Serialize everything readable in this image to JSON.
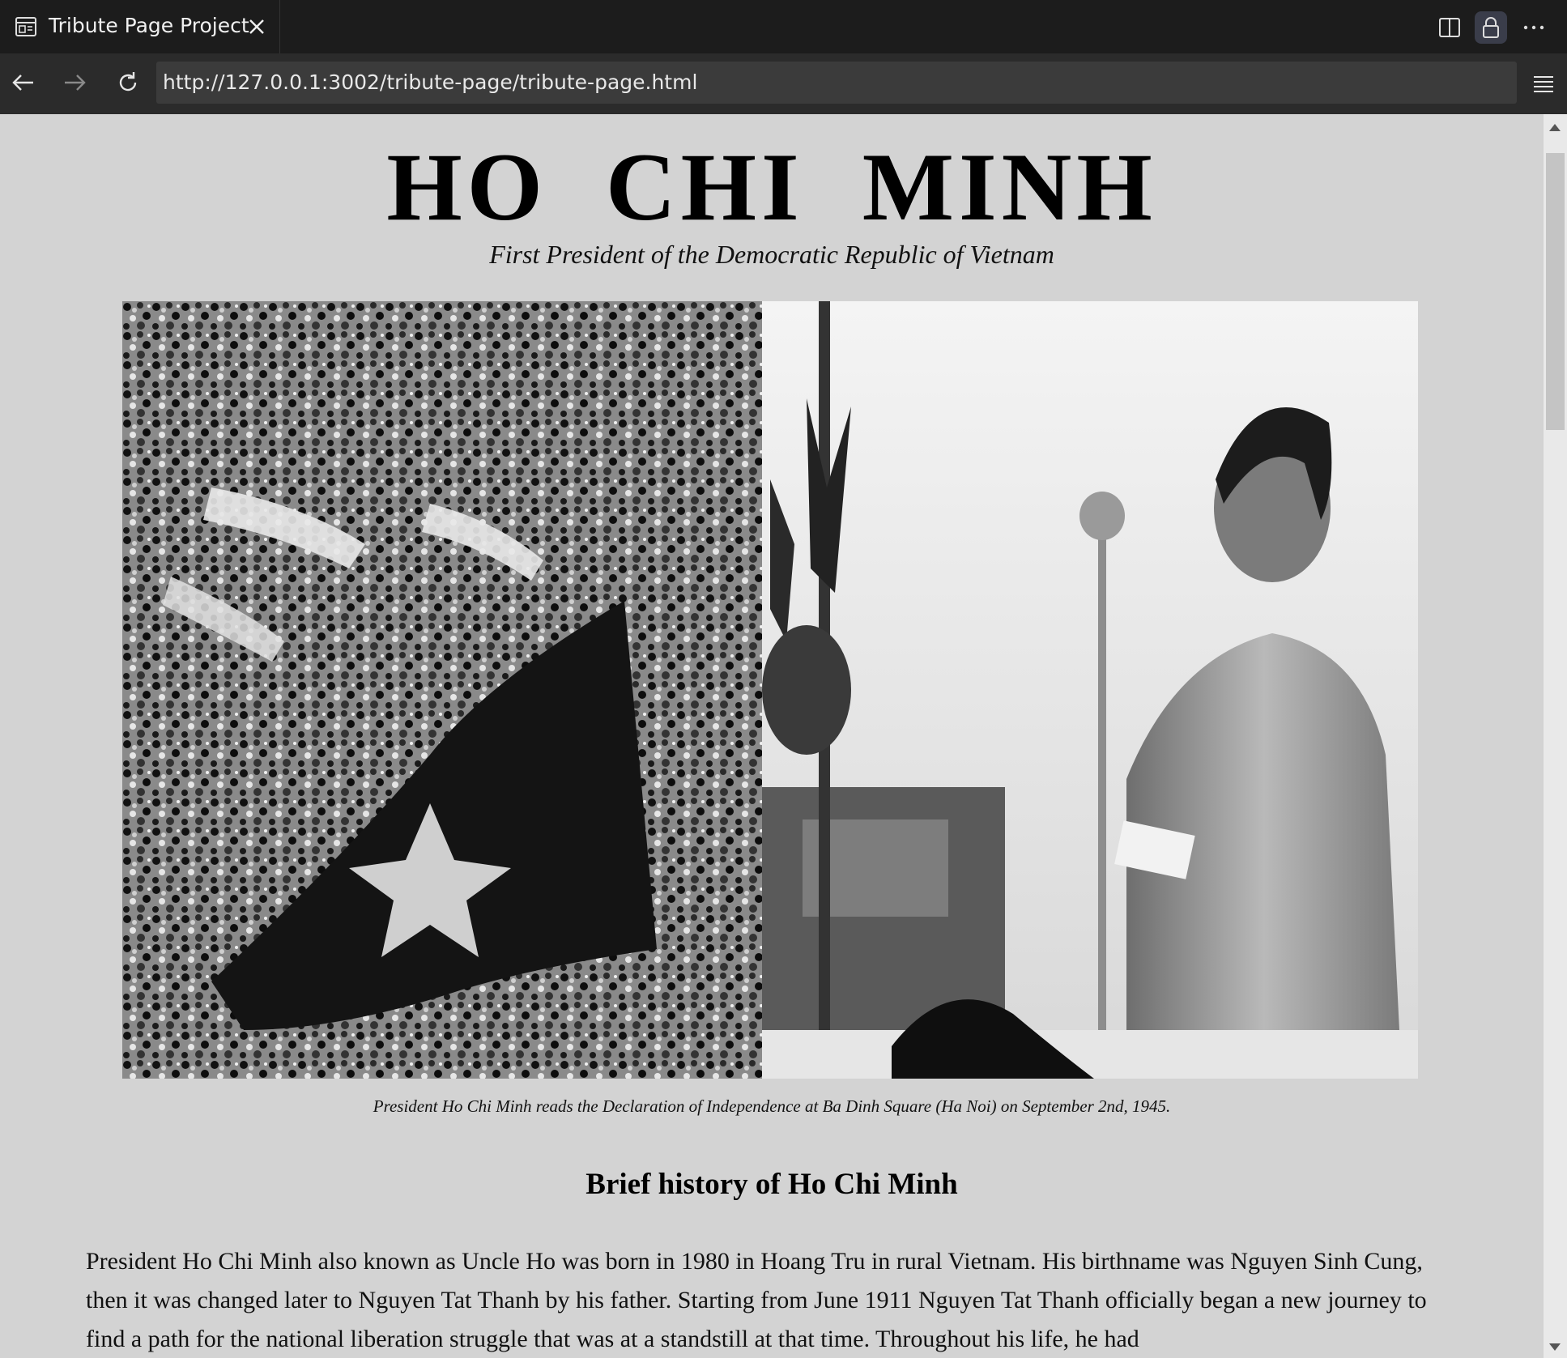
{
  "browser": {
    "tab_title": "Tribute Page Project",
    "url": "http://127.0.0.1:3002/tribute-page/tribute-page.html"
  },
  "page": {
    "title": "HO CHI MINH",
    "subtitle": "First President of the Democratic Republic of Vietnam",
    "caption": "President Ho Chi Minh reads the Declaration of Independence at Ba Dinh Square (Ha Noi) on September 2nd, 1945.",
    "heading": "Brief history of Ho Chi Minh",
    "paragraph": "President Ho Chi Minh also known as Uncle Ho was born in 1980 in Hoang Tru in rural Vietnam. His birthname was Nguyen Sinh Cung, then it was changed later to Nguyen Tat Thanh by his father. Starting from June 1911 Nguyen Tat Thanh officially began a new journey to find a path for the national liberation struggle that was at a standstill at that time. Throughout his life, he had"
  }
}
